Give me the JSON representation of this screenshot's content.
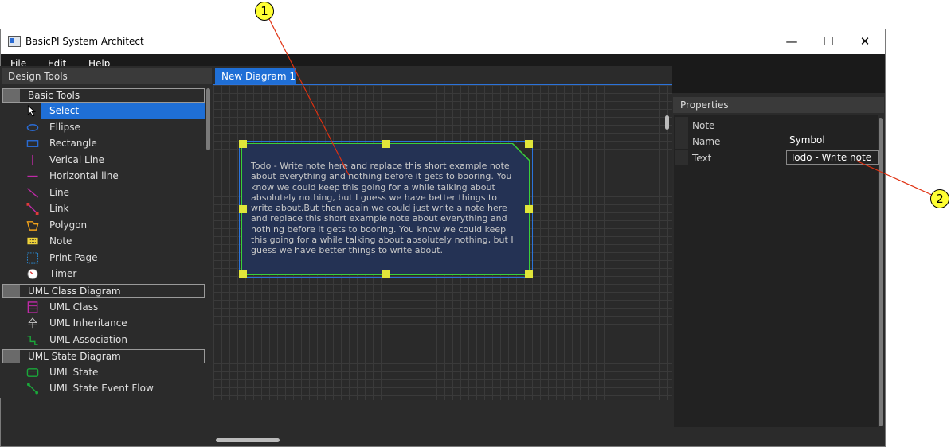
{
  "window": {
    "title": "BasicPI System Architect"
  },
  "window_controls": {
    "minimize": "—",
    "maximize": "☐",
    "close": "✕"
  },
  "menu": {
    "file": "File",
    "edit": "Edit",
    "help": "Help"
  },
  "toolbar": {
    "icons": [
      "new-icon",
      "save-icon",
      "open-icon",
      "delete-icon",
      "print-icon",
      "cut-icon",
      "copy-icon",
      "paste-icon",
      "grid-icon",
      "bring-front-icon",
      "send-back-icon",
      "bring-forward-icon",
      "send-backward-icon",
      "align-left-icon",
      "align-top-icon",
      "align-center-icon",
      "align-bottom-icon",
      "distribute-vertical-icon",
      "distribute-horizontal-icon"
    ]
  },
  "left_panel": {
    "title": "Design Tools",
    "groups": [
      {
        "label": "Basic Tools",
        "items": [
          "Select",
          "Ellipse",
          "Rectangle",
          "Verical Line",
          "Horizontal line",
          "Line",
          "Link",
          "Polygon",
          "Note",
          "Print Page",
          "Timer"
        ]
      },
      {
        "label": "UML Class Diagram",
        "items": [
          "UML Class",
          "UML Inheritance",
          "UML Association"
        ]
      },
      {
        "label": "UML State Diagram",
        "items": [
          "UML State",
          "UML State Event Flow"
        ]
      }
    ],
    "selected": "Select"
  },
  "tabs": {
    "active": "New Diagram 1"
  },
  "note": {
    "text": "Todo - Write note here and replace this short example note about everything and nothing before it gets to booring. You know we could keep this going for a while talking about absolutely nothing, but I guess we have better things to write about.But then again we could just write a note here and replace this short example note about everything and nothing before it gets to booring. You know we could keep this going for a while talking about absolutely nothing, but I guess we have better things to write about."
  },
  "properties": {
    "title": "Properties",
    "section": "Note",
    "rows": [
      {
        "key": "Name",
        "value": "Symbol"
      },
      {
        "key": "Text",
        "value": "Todo - Write note"
      }
    ]
  },
  "callouts": {
    "one": "1",
    "two": "2"
  },
  "colors": {
    "accent": "#1f6fd6",
    "callout": "#ffff33",
    "leader": "#e03010",
    "handle": "#e1e63a"
  }
}
